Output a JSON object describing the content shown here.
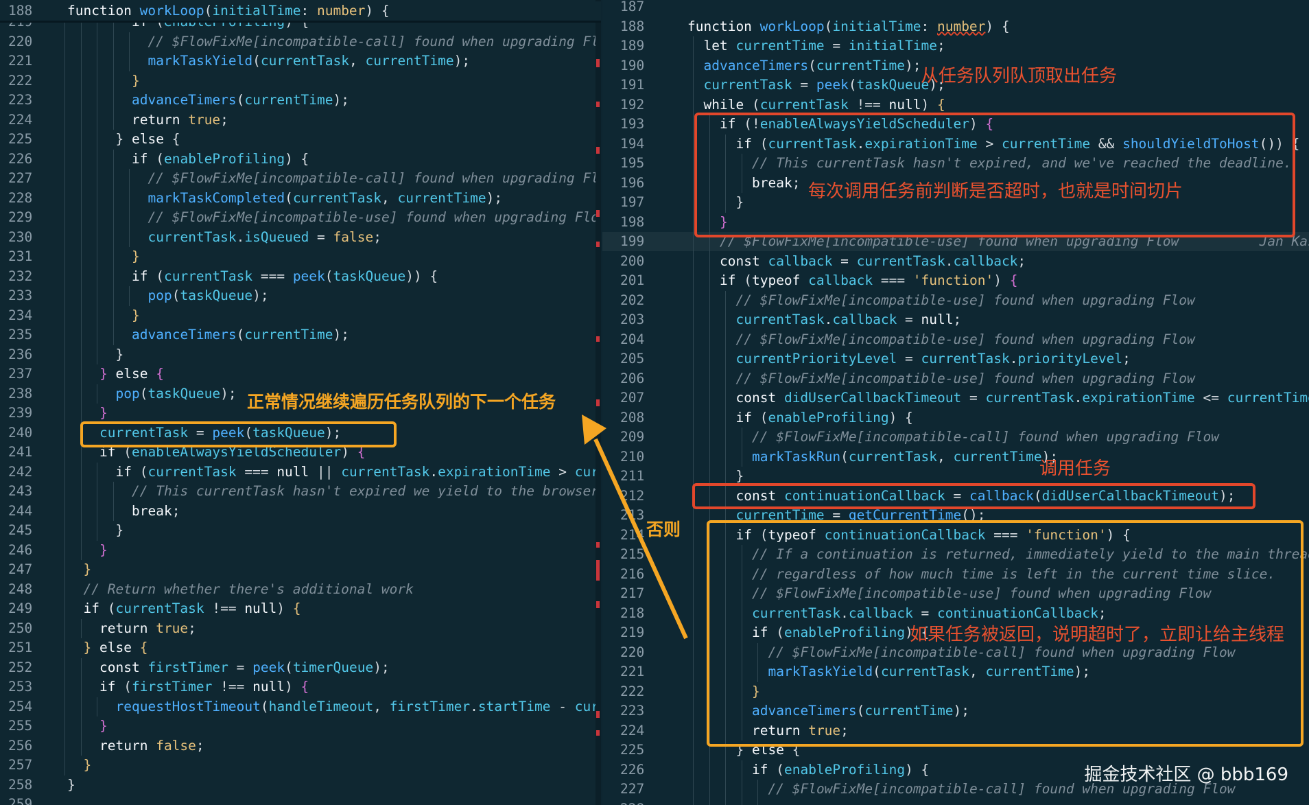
{
  "left": {
    "header": {
      "num": "188",
      "text": "function workLoop(initialTime: number) {"
    },
    "lines": [
      {
        "num": "219",
        "indent": 4,
        "html": "<span class='kw'>if</span> (<span class='var'>enableProfiling</span>) {"
      },
      {
        "num": "220",
        "indent": 5,
        "html": "<span class='cm'>// $FlowFixMe[incompatible-call] found when upgrading Flow</span>"
      },
      {
        "num": "221",
        "indent": 5,
        "html": "<span class='fn'>markTaskYield</span>(<span class='var'>currentTask</span>, <span class='var'>currentTime</span>);"
      },
      {
        "num": "222",
        "indent": 4,
        "html": "<span class='str'>}</span>"
      },
      {
        "num": "223",
        "indent": 4,
        "html": "<span class='fn'>advanceTimers</span>(<span class='var'>currentTime</span>);"
      },
      {
        "num": "224",
        "indent": 4,
        "html": "<span class='kw'>return</span> <span class='tp'>true</span>;"
      },
      {
        "num": "225",
        "indent": 3,
        "html": "} <span class='kw'>else</span> {"
      },
      {
        "num": "226",
        "indent": 4,
        "html": "<span class='kw'>if</span> (<span class='var'>enableProfiling</span>) {"
      },
      {
        "num": "227",
        "indent": 5,
        "html": "<span class='cm'>// $FlowFixMe[incompatible-call] found when upgrading Flow</span>"
      },
      {
        "num": "228",
        "indent": 5,
        "html": "<span class='fn'>markTaskCompleted</span>(<span class='var'>currentTask</span>, <span class='var'>currentTime</span>);"
      },
      {
        "num": "229",
        "indent": 5,
        "html": "<span class='cm'>// $FlowFixMe[incompatible-use] found when upgrading Flow</span>"
      },
      {
        "num": "230",
        "indent": 5,
        "html": "<span class='var'>currentTask</span>.<span class='var'>isQueued</span> = <span class='tp'>false</span>;"
      },
      {
        "num": "231",
        "indent": 4,
        "html": "<span class='str'>}</span>"
      },
      {
        "num": "232",
        "indent": 4,
        "html": "<span class='kw'>if</span> (<span class='var'>currentTask</span> === <span class='fn'>peek</span>(<span class='var'>taskQueue</span>)) {"
      },
      {
        "num": "233",
        "indent": 5,
        "html": "<span class='fn'>pop</span>(<span class='var'>taskQueue</span>);"
      },
      {
        "num": "234",
        "indent": 4,
        "html": "<span class='str'>}</span>"
      },
      {
        "num": "235",
        "indent": 4,
        "html": "<span class='fn'>advanceTimers</span>(<span class='var'>currentTime</span>);"
      },
      {
        "num": "236",
        "indent": 3,
        "html": "}"
      },
      {
        "num": "237",
        "indent": 2,
        "html": "<span style='color:#d16fd1'>}</span> <span class='kw'>else</span> <span style='color:#d16fd1'>{</span>"
      },
      {
        "num": "238",
        "indent": 3,
        "html": "<span class='fn'>pop</span>(<span class='var'>taskQueue</span>);"
      },
      {
        "num": "239",
        "indent": 2,
        "html": "<span style='color:#d16fd1'>}</span>"
      },
      {
        "num": "240",
        "indent": 2,
        "html": "<span class='var'>currentTask</span> = <span class='fn'>peek</span>(<span class='var'>taskQueue</span>);"
      },
      {
        "num": "241",
        "indent": 2,
        "html": "<span class='kw'>if</span> (<span class='var'>enableAlwaysYieldScheduler</span>) <span style='color:#d16fd1'>{</span>"
      },
      {
        "num": "242",
        "indent": 3,
        "html": "<span class='kw'>if</span> (<span class='var'>currentTask</span> === <span class='kw'>null</span> || <span class='var'>currentTask</span>.<span class='var'>expirationTime</span> > <span class='var'>curre</span>"
      },
      {
        "num": "243",
        "indent": 4,
        "html": "<span class='cm'>// This currentTask hasn't expired we yield to the browser ta</span>"
      },
      {
        "num": "244",
        "indent": 4,
        "html": "<span class='kw'>break</span>;"
      },
      {
        "num": "245",
        "indent": 3,
        "html": "}"
      },
      {
        "num": "246",
        "indent": 2,
        "html": "<span style='color:#d16fd1'>}</span>"
      },
      {
        "num": "247",
        "indent": 1,
        "html": "<span class='str'>}</span>"
      },
      {
        "num": "248",
        "indent": 1,
        "html": "<span class='cm'>// Return whether there's additional work</span>"
      },
      {
        "num": "249",
        "indent": 1,
        "html": "<span class='kw'>if</span> (<span class='var'>currentTask</span> !== <span class='kw'>null</span>) <span class='str'>{</span>"
      },
      {
        "num": "250",
        "indent": 2,
        "html": "<span class='kw'>return</span> <span class='tp'>true</span>;"
      },
      {
        "num": "251",
        "indent": 1,
        "html": "<span class='str'>}</span> <span class='kw'>else</span> <span class='str'>{</span>"
      },
      {
        "num": "252",
        "indent": 2,
        "html": "<span class='kw'>const</span> <span class='var'>firstTimer</span> = <span class='fn'>peek</span>(<span class='var'>timerQueue</span>);"
      },
      {
        "num": "253",
        "indent": 2,
        "html": "<span class='kw'>if</span> (<span class='var'>firstTimer</span> !== <span class='kw'>null</span>) <span style='color:#d16fd1'>{</span>"
      },
      {
        "num": "254",
        "indent": 3,
        "html": "<span class='fn'>requestHostTimeout</span>(<span class='var'>handleTimeout</span>, <span class='var'>firstTimer</span>.<span class='var'>startTime</span> - <span class='var'>curre</span>"
      },
      {
        "num": "255",
        "indent": 2,
        "html": "<span style='color:#d16fd1'>}</span>"
      },
      {
        "num": "256",
        "indent": 2,
        "html": "<span class='kw'>return</span> <span class='tp'>false</span>;"
      },
      {
        "num": "257",
        "indent": 1,
        "html": "<span class='str'>}</span>"
      },
      {
        "num": "258",
        "indent": 0,
        "html": "}"
      },
      {
        "num": "259",
        "indent": 0,
        "html": ""
      }
    ]
  },
  "right": {
    "lines": [
      {
        "num": "187",
        "indent": 0,
        "html": ""
      },
      {
        "num": "188",
        "indent": 0,
        "html": "<span class='kw'>function</span> <span class='fn'>workLoop</span>(<span class='var'>initialTime</span>: <span class='tp' style='text-decoration:underline wavy #e2472b'>number</span>) {"
      },
      {
        "num": "189",
        "indent": 1,
        "html": "<span class='kw'>let</span> <span class='var'>currentTime</span> = <span class='var'>initialTime</span>;"
      },
      {
        "num": "190",
        "indent": 1,
        "html": "<span class='fn'>advanceTimers</span>(<span class='var'>currentTime</span>);"
      },
      {
        "num": "191",
        "indent": 1,
        "html": "<span class='var'>currentTask</span> = <span class='fn'>peek</span>(<span class='var'>taskQueue</span>);"
      },
      {
        "num": "192",
        "indent": 1,
        "html": "<span class='kw'>while</span> (<span class='var'>currentTask</span> !== <span class='kw'>null</span>) <span class='str'>{</span>"
      },
      {
        "num": "193",
        "indent": 2,
        "html": "<span class='kw'>if</span> (!<span class='var'>enableAlwaysYieldScheduler</span>) <span style='color:#d16fd1'>{</span>"
      },
      {
        "num": "194",
        "indent": 3,
        "html": "<span class='kw'>if</span> (<span class='var'>currentTask</span>.<span class='var'>expirationTime</span> > <span class='var'>currentTime</span> && <span class='fn'>shouldYieldToHost</span>()) {"
      },
      {
        "num": "195",
        "indent": 4,
        "html": "<span class='cm'>// This currentTask hasn't expired, and we've reached the deadline.</span>"
      },
      {
        "num": "196",
        "indent": 4,
        "html": "<span class='kw'>break</span>;"
      },
      {
        "num": "197",
        "indent": 3,
        "html": "}"
      },
      {
        "num": "198",
        "indent": 2,
        "html": "<span style='color:#d16fd1'>}</span>"
      },
      {
        "num": "199",
        "indent": 2,
        "html": "<span class='cm'>// $FlowFixMe[incompatible-use] found when upgrading Flow          Jan Kassens,</span>"
      },
      {
        "num": "200",
        "indent": 2,
        "html": "<span class='kw'>const</span> <span class='var'>callback</span> = <span class='var'>currentTask</span>.<span class='var'>callback</span>;"
      },
      {
        "num": "201",
        "indent": 2,
        "html": "<span class='kw'>if</span> (<span class='kw'>typeof</span> <span class='var'>callback</span> === <span class='str'>'function'</span>) <span style='color:#d16fd1'>{</span>"
      },
      {
        "num": "202",
        "indent": 3,
        "html": "<span class='cm'>// $FlowFixMe[incompatible-use] found when upgrading Flow</span>"
      },
      {
        "num": "203",
        "indent": 3,
        "html": "<span class='var'>currentTask</span>.<span class='var'>callback</span> = <span class='kw'>null</span>;"
      },
      {
        "num": "204",
        "indent": 3,
        "html": "<span class='cm'>// $FlowFixMe[incompatible-use] found when upgrading Flow</span>"
      },
      {
        "num": "205",
        "indent": 3,
        "html": "<span class='var'>currentPriorityLevel</span> = <span class='var'>currentTask</span>.<span class='var'>priorityLevel</span>;"
      },
      {
        "num": "206",
        "indent": 3,
        "html": "<span class='cm'>// $FlowFixMe[incompatible-use] found when upgrading Flow</span>"
      },
      {
        "num": "207",
        "indent": 3,
        "html": "<span class='kw'>const</span> <span class='var'>didUserCallbackTimeout</span> = <span class='var'>currentTask</span>.<span class='var'>expirationTime</span> <= <span class='var'>currentTime</span>;"
      },
      {
        "num": "208",
        "indent": 3,
        "html": "<span class='kw'>if</span> (<span class='var'>enableProfiling</span>) {"
      },
      {
        "num": "209",
        "indent": 4,
        "html": "<span class='cm'>// $FlowFixMe[incompatible-call] found when upgrading Flow</span>"
      },
      {
        "num": "210",
        "indent": 4,
        "html": "<span class='fn'>markTaskRun</span>(<span class='var'>currentTask</span>, <span class='var'>currentTime</span>);"
      },
      {
        "num": "211",
        "indent": 3,
        "html": "}"
      },
      {
        "num": "212",
        "indent": 3,
        "html": "<span class='kw'>const</span> <span class='var'>continuationCallback</span> = <span class='fn'>callback</span>(<span class='var'>didUserCallbackTimeout</span>);"
      },
      {
        "num": "213",
        "indent": 3,
        "html": "<span class='var'>currentTime</span> = <span class='fn'>getCurrentTime</span>();"
      },
      {
        "num": "214",
        "indent": 3,
        "html": "<span class='kw'>if</span> (<span class='kw'>typeof</span> <span class='var'>continuationCallback</span> === <span class='str'>'function'</span>) {"
      },
      {
        "num": "215",
        "indent": 4,
        "html": "<span class='cm'>// If a continuation is returned, immediately yield to the main thread</span>"
      },
      {
        "num": "216",
        "indent": 4,
        "html": "<span class='cm'>// regardless of how much time is left in the current time slice.</span>"
      },
      {
        "num": "217",
        "indent": 4,
        "html": "<span class='cm'>// $FlowFixMe[incompatible-use] found when upgrading Flow</span>"
      },
      {
        "num": "218",
        "indent": 4,
        "html": "<span class='var'>currentTask</span>.<span class='var'>callback</span> = <span class='var'>continuationCallback</span>;"
      },
      {
        "num": "219",
        "indent": 4,
        "html": "<span class='kw'>if</span> (<span class='var'>enableProfiling</span>) {"
      },
      {
        "num": "220",
        "indent": 5,
        "html": "<span class='cm'>// $FlowFixMe[incompatible-call] found when upgrading Flow</span>"
      },
      {
        "num": "221",
        "indent": 5,
        "html": "<span class='fn'>markTaskYield</span>(<span class='var'>currentTask</span>, <span class='var'>currentTime</span>);"
      },
      {
        "num": "222",
        "indent": 4,
        "html": "<span class='str'>}</span>"
      },
      {
        "num": "223",
        "indent": 4,
        "html": "<span class='fn'>advanceTimers</span>(<span class='var'>currentTime</span>);"
      },
      {
        "num": "224",
        "indent": 4,
        "html": "<span class='kw'>return</span> <span class='tp'>true</span>;"
      },
      {
        "num": "225",
        "indent": 3,
        "html": "} <span class='kw'>else</span> {"
      },
      {
        "num": "226",
        "indent": 4,
        "html": "<span class='kw'>if</span> (<span class='var'>enableProfiling</span>) {"
      },
      {
        "num": "227",
        "indent": 5,
        "html": "<span class='cm'>// $FlowFixMe[incompatible-call] found when upgrading Flow</span>"
      },
      {
        "num": "228",
        "indent": 5,
        "html": ""
      }
    ]
  },
  "annotations": {
    "left_next_task": "正常情况继续遍历任务队列的下一个任务",
    "otherwise": "否则",
    "take_task": "从任务队列队顶取出任务",
    "time_slice": "每次调用任务前判断是否超时，也就是时间切片",
    "call_task": "调用任务",
    "yield_main": "如果任务被返回，说明超时了，立即让给主线程"
  },
  "watermark": "掘金技术社区 @ bbb169",
  "colors": {
    "background": "#0f2731",
    "orange": "#f5a623",
    "red": "#e2472b"
  }
}
